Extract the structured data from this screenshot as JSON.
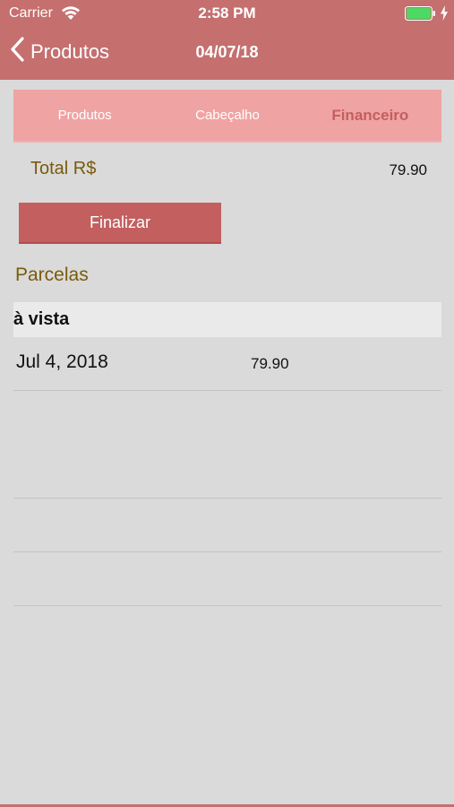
{
  "status_bar": {
    "carrier": "Carrier",
    "time": "2:58 PM",
    "wifi_icon": "wifi-icon",
    "battery_icon": "battery-icon",
    "charging_icon": "charging-bolt-icon"
  },
  "nav": {
    "back_label": "Produtos",
    "back_icon": "chevron-left-icon",
    "title": "04/07/18"
  },
  "tabs": [
    {
      "label": "Produtos",
      "active": false
    },
    {
      "label": "Cabeçalho",
      "active": false
    },
    {
      "label": "Financeiro",
      "active": true
    }
  ],
  "total": {
    "label": "Total R$",
    "value": "79.90"
  },
  "finalizar_label": "Finalizar",
  "parcelas": {
    "title": "Parcelas",
    "group_header": "à vista",
    "rows": [
      {
        "date": "Jul 4, 2018",
        "amount": "79.90"
      }
    ]
  },
  "colors": {
    "accent": "#c56f6f",
    "tab_bar": "#f0a3a3",
    "button": "#c35f5f",
    "label_gold": "#7a5a0c",
    "battery_green": "#4cd964",
    "background": "#dadada"
  }
}
